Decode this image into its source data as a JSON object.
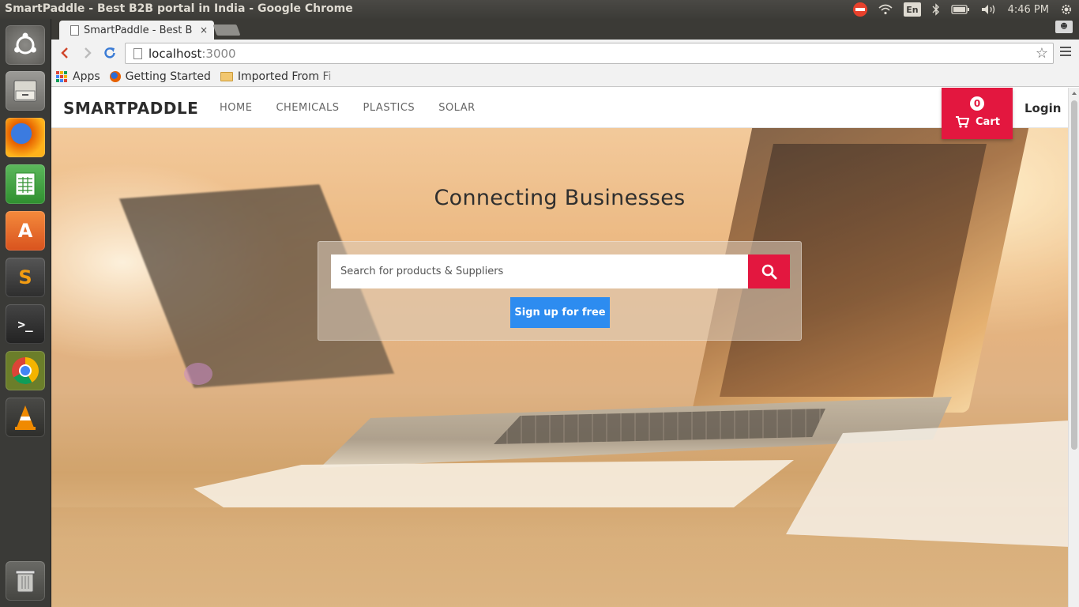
{
  "os": {
    "window_title": "SmartPaddle - Best B2B portal in India - Google Chrome",
    "keyboard_layout": "En",
    "clock": "4:46 PM",
    "launcher": [
      {
        "name": "Ubuntu Dash",
        "icon": "ubuntu-logo-icon"
      },
      {
        "name": "Files",
        "icon": "file-cabinet-icon"
      },
      {
        "name": "Firefox",
        "icon": "firefox-icon"
      },
      {
        "name": "LibreOffice Calc",
        "icon": "spreadsheet-icon"
      },
      {
        "name": "Ubuntu Software Center",
        "icon": "software-center-icon"
      },
      {
        "name": "Sublime Text",
        "icon": "sublime-text-icon"
      },
      {
        "name": "Terminal",
        "icon": "terminal-icon"
      },
      {
        "name": "Google Chrome",
        "icon": "chrome-icon"
      },
      {
        "name": "VLC",
        "icon": "vlc-icon"
      },
      {
        "name": "Trash",
        "icon": "trash-icon"
      }
    ]
  },
  "browser": {
    "tab_title": "SmartPaddle - Best B",
    "tab_close_glyph": "×",
    "url_host": "localhost",
    "url_port": ":3000",
    "bookmarks": [
      {
        "label": "Apps",
        "icon": "apps-grid-icon"
      },
      {
        "label": "Getting Started",
        "icon": "firefox-icon"
      },
      {
        "label": "Imported From Fi",
        "icon": "folder-icon"
      }
    ]
  },
  "site": {
    "brand": "SMARTPADDLE",
    "nav": [
      "HOME",
      "CHEMICALS",
      "PLASTICS",
      "SOLAR"
    ],
    "cart_count": "0",
    "cart_label": "Cart",
    "login_label": "Login",
    "hero_title": "Connecting Businesses",
    "search_placeholder": "Search for products & Suppliers",
    "signup_label": "Sign up for free",
    "colors": {
      "accent_red": "#e3173f",
      "signup_blue": "#2d8cf0",
      "brand_text": "#2c2c2c"
    }
  }
}
